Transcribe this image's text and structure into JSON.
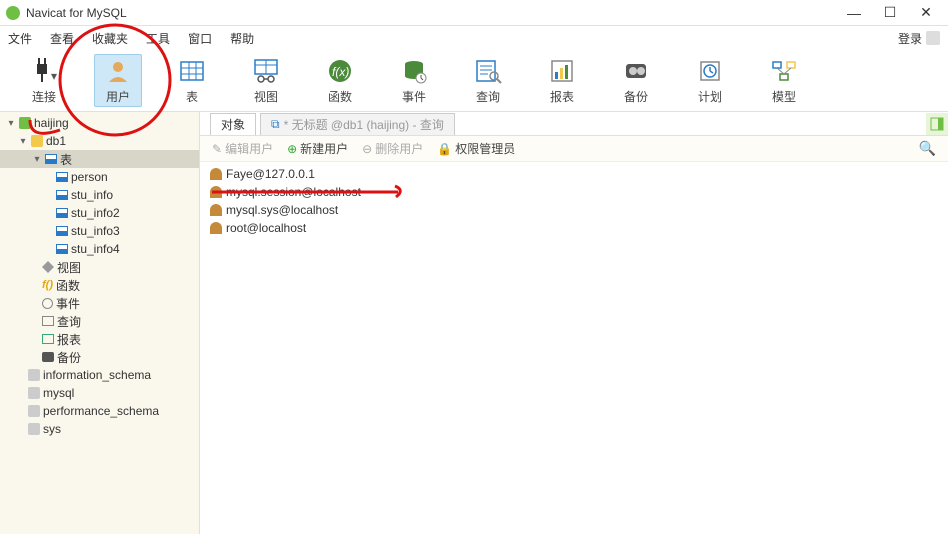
{
  "title": "Navicat for MySQL",
  "menu": {
    "file": "文件",
    "view": "查看",
    "fav": "收藏夹",
    "tools": "工具",
    "window": "窗口",
    "help": "帮助",
    "login": "登录"
  },
  "toolbar": {
    "connect": "连接",
    "user": "用户",
    "table": "表",
    "viewv": "视图",
    "func": "函数",
    "event": "事件",
    "query": "查询",
    "report": "报表",
    "backup": "备份",
    "plan": "计划",
    "model": "模型"
  },
  "tree": {
    "conn": "haijing",
    "db": "db1",
    "tables_node": "表",
    "tables": [
      "person",
      "stu_info",
      "stu_info2",
      "stu_info3",
      "stu_info4"
    ],
    "views": "视图",
    "funcs": "函数",
    "events": "事件",
    "queries": "查询",
    "reports": "报表",
    "backups": "备份",
    "sysdbs": [
      "information_schema",
      "mysql",
      "performance_schema",
      "sys"
    ]
  },
  "tabs": {
    "obj": "对象",
    "q_icon": "⧉",
    "q_text": "* 无标题 @db1 (haijing) - 查询"
  },
  "subbar": {
    "edit": "编辑用户",
    "new": "新建用户",
    "del": "删除用户",
    "priv": "权限管理员"
  },
  "users": [
    "Faye@127.0.0.1",
    "mysql.session@localhost",
    "mysql.sys@localhost",
    "root@localhost"
  ]
}
